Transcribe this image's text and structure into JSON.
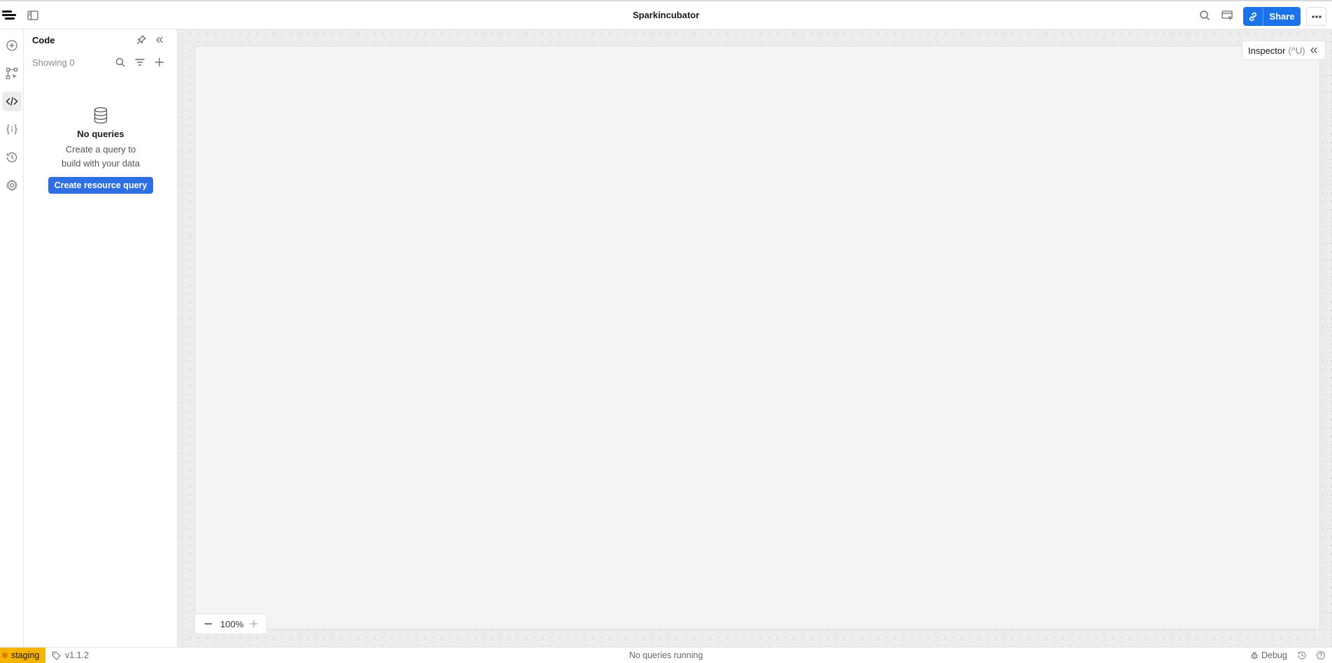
{
  "topbar": {
    "app_title": "Sparkincubator",
    "share_label": "Share",
    "icons": [
      "logo-icon",
      "panel-toggle-icon",
      "search-icon",
      "preview-icon",
      "link-icon",
      "more-icon"
    ]
  },
  "rail": {
    "items": [
      "add-component-icon",
      "components-tree-icon",
      "code-icon",
      "state-icon",
      "history-icon",
      "settings-icon"
    ],
    "active": "code-icon"
  },
  "code_panel": {
    "title": "Code",
    "showing_label": "Showing 0",
    "empty_title": "No queries",
    "empty_description": "Create a query to build with your data",
    "create_button_label": "Create resource query"
  },
  "canvas": {
    "inspector_label": "Inspector",
    "inspector_shortcut": "(^U)",
    "zoom_level": "100%"
  },
  "statusbar": {
    "environment": "staging",
    "version": "v1.1.2",
    "queries_status": "No queries running",
    "debug_label": "Debug"
  },
  "colors": {
    "accent": "#1a73e8",
    "create_button": "#2f6fe4",
    "environment_badge": "#f4b400"
  }
}
